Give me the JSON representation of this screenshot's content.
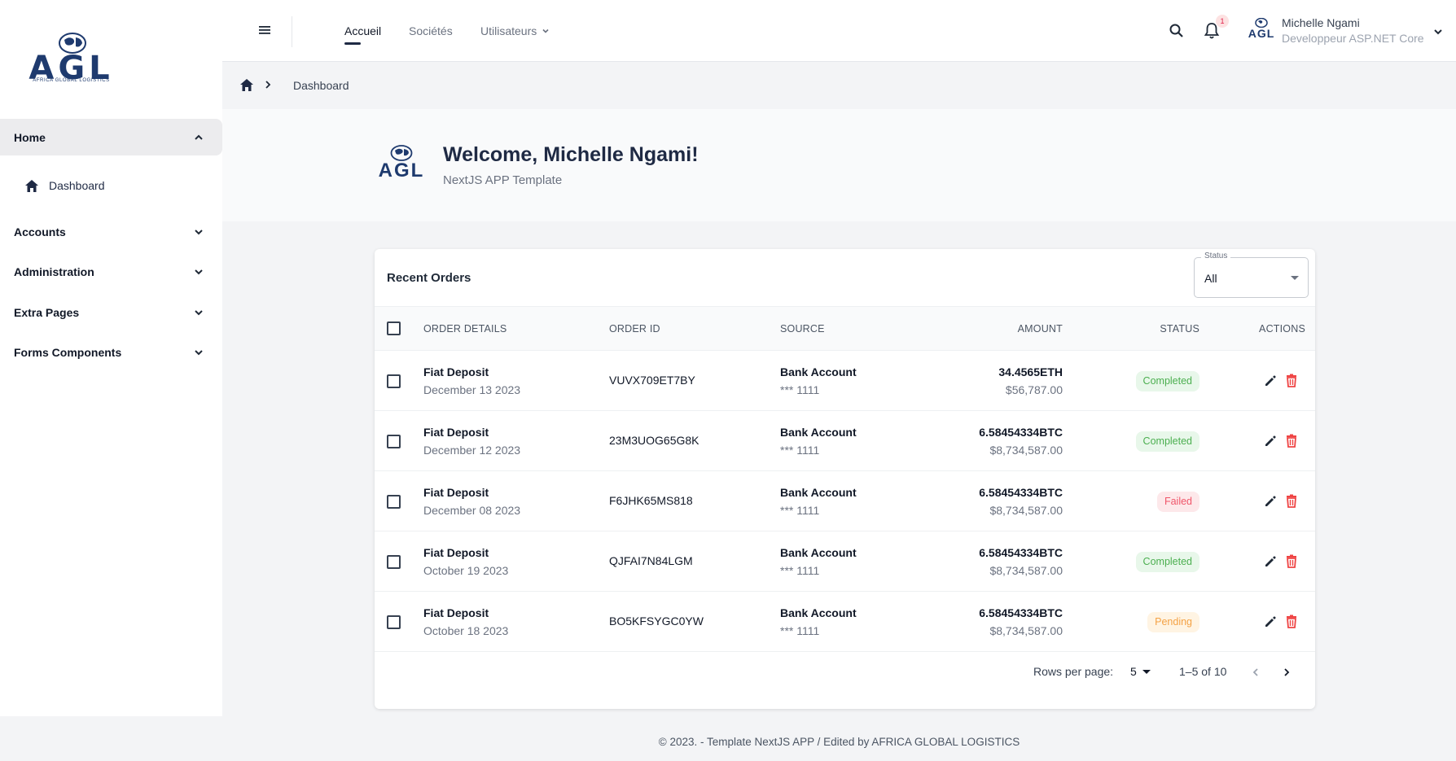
{
  "brand": {
    "logo_text": "AGL",
    "logo_tagline": "AFRICA GLOBAL LOGISTICS"
  },
  "sidebar": {
    "groups": [
      {
        "label": "Home",
        "expanded": true
      },
      {
        "label": "Accounts",
        "expanded": false
      },
      {
        "label": "Administration",
        "expanded": false
      },
      {
        "label": "Extra Pages",
        "expanded": false
      },
      {
        "label": "Forms Components",
        "expanded": false
      }
    ],
    "home_items": [
      {
        "label": "Dashboard",
        "icon": "home-icon"
      }
    ]
  },
  "topbar": {
    "nav": [
      {
        "label": "Accueil",
        "active": true
      },
      {
        "label": "Sociétés",
        "active": false
      },
      {
        "label": "Utilisateurs",
        "active": false,
        "has_dropdown": true
      }
    ],
    "notification_count": "1",
    "user": {
      "name": "Michelle Ngami",
      "role": "Developpeur ASP.NET Core"
    }
  },
  "breadcrumb": {
    "current": "Dashboard"
  },
  "welcome": {
    "title": "Welcome, Michelle Ngami!",
    "subtitle": "NextJS APP Template"
  },
  "orders": {
    "title": "Recent Orders",
    "status_filter": {
      "legend": "Status",
      "value": "All"
    },
    "columns": {
      "details": "ORDER DETAILS",
      "id": "ORDER ID",
      "source": "SOURCE",
      "amount": "AMOUNT",
      "status": "STATUS",
      "actions": "ACTIONS"
    },
    "rows": [
      {
        "type": "Fiat Deposit",
        "date": "December 13 2023",
        "id": "VUVX709ET7BY",
        "source": "Bank Account",
        "source_sub": "*** 1111",
        "amount": "34.4565ETH",
        "amount_usd": "$56,787.00",
        "status": "Completed",
        "status_kind": "completed"
      },
      {
        "type": "Fiat Deposit",
        "date": "December 12 2023",
        "id": "23M3UOG65G8K",
        "source": "Bank Account",
        "source_sub": "*** 1111",
        "amount": "6.58454334BTC",
        "amount_usd": "$8,734,587.00",
        "status": "Completed",
        "status_kind": "completed"
      },
      {
        "type": "Fiat Deposit",
        "date": "December 08 2023",
        "id": "F6JHK65MS818",
        "source": "Bank Account",
        "source_sub": "*** 1111",
        "amount": "6.58454334BTC",
        "amount_usd": "$8,734,587.00",
        "status": "Failed",
        "status_kind": "failed"
      },
      {
        "type": "Fiat Deposit",
        "date": "October 19 2023",
        "id": "QJFAI7N84LGM",
        "source": "Bank Account",
        "source_sub": "*** 1111",
        "amount": "6.58454334BTC",
        "amount_usd": "$8,734,587.00",
        "status": "Completed",
        "status_kind": "completed"
      },
      {
        "type": "Fiat Deposit",
        "date": "October 18 2023",
        "id": "BO5KFSYGC0YW",
        "source": "Bank Account",
        "source_sub": "*** 1111",
        "amount": "6.58454334BTC",
        "amount_usd": "$8,734,587.00",
        "status": "Pending",
        "status_kind": "pending"
      }
    ],
    "pagination": {
      "rows_label": "Rows per page:",
      "rows_value": "5",
      "range": "1–5 of 10"
    }
  },
  "footer": {
    "text": "© 2023. - Template NextJS APP / Edited by AFRICA GLOBAL LOGISTICS"
  },
  "colors": {
    "accent": "#1f2a44",
    "logo": "#1e3a6e",
    "completed": "#4caf50",
    "failed": "#f0566a",
    "pending": "#f4a245",
    "delete": "#ef4444"
  }
}
